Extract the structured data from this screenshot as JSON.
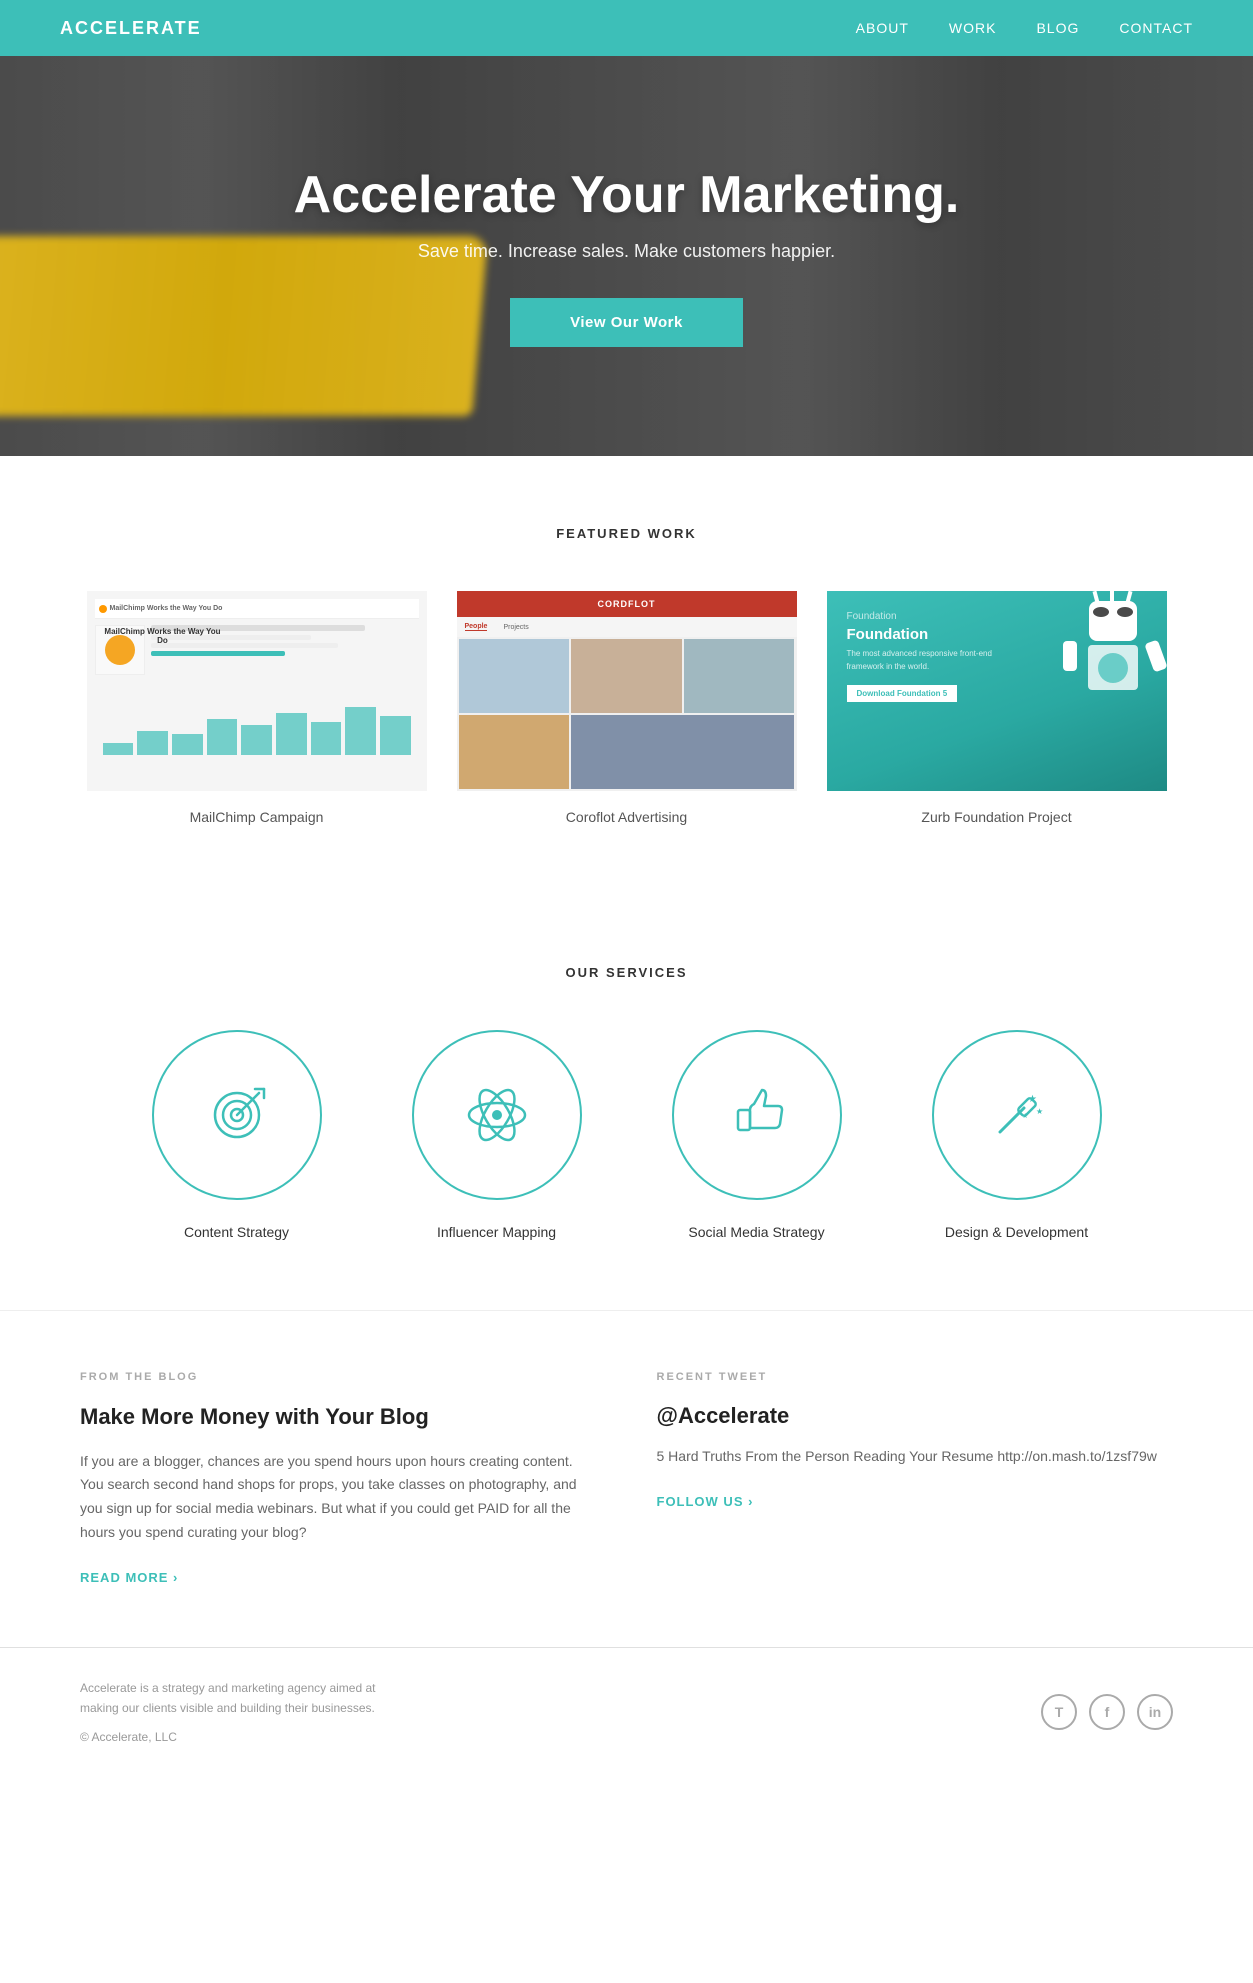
{
  "nav": {
    "logo": "ACCELERATE",
    "links": [
      "ABOUT",
      "WORK",
      "BLOG",
      "CONTACT"
    ]
  },
  "hero": {
    "title": "Accelerate Your Marketing.",
    "subtitle": "Save time. Increase sales. Make customers happier.",
    "cta": "View Our Work"
  },
  "featured_work": {
    "section_title": "FEATURED WORK",
    "items": [
      {
        "label": "MailChimp Campaign"
      },
      {
        "label": "Coroflot Advertising"
      },
      {
        "label": "Zurb Foundation Project"
      }
    ]
  },
  "services": {
    "section_title": "OUR SERVICES",
    "items": [
      {
        "label": "Content Strategy",
        "icon": "target"
      },
      {
        "label": "Influencer Mapping",
        "icon": "atom"
      },
      {
        "label": "Social Media Strategy",
        "icon": "thumbs-up"
      },
      {
        "label": "Design & Development",
        "icon": "magic-wand"
      }
    ]
  },
  "blog": {
    "section_label": "FROM THE BLOG",
    "title": "Make More Money with Your Blog",
    "text": "If you are a blogger, chances are you spend hours upon hours creating content. You search second hand shops for props, you take classes on photography, and you sign up for social media webinars. But what if you could get PAID for all the hours you spend curating your blog?",
    "read_more": "READ MORE ›"
  },
  "tweet": {
    "section_label": "RECENT TWEET",
    "handle": "@Accelerate",
    "text": "5 Hard Truths From the Person Reading Your Resume http://on.mash.to/1zsf79w",
    "follow": "FOLLOW US ›"
  },
  "footer": {
    "description": "Accelerate is a strategy and marketing agency aimed at making our clients visible and building their businesses.",
    "copyright": "© Accelerate, LLC",
    "social_icons": [
      "T",
      "f",
      "in"
    ]
  },
  "colors": {
    "teal": "#3dbfb8",
    "dark": "#222",
    "mid": "#666",
    "light": "#aaa"
  }
}
